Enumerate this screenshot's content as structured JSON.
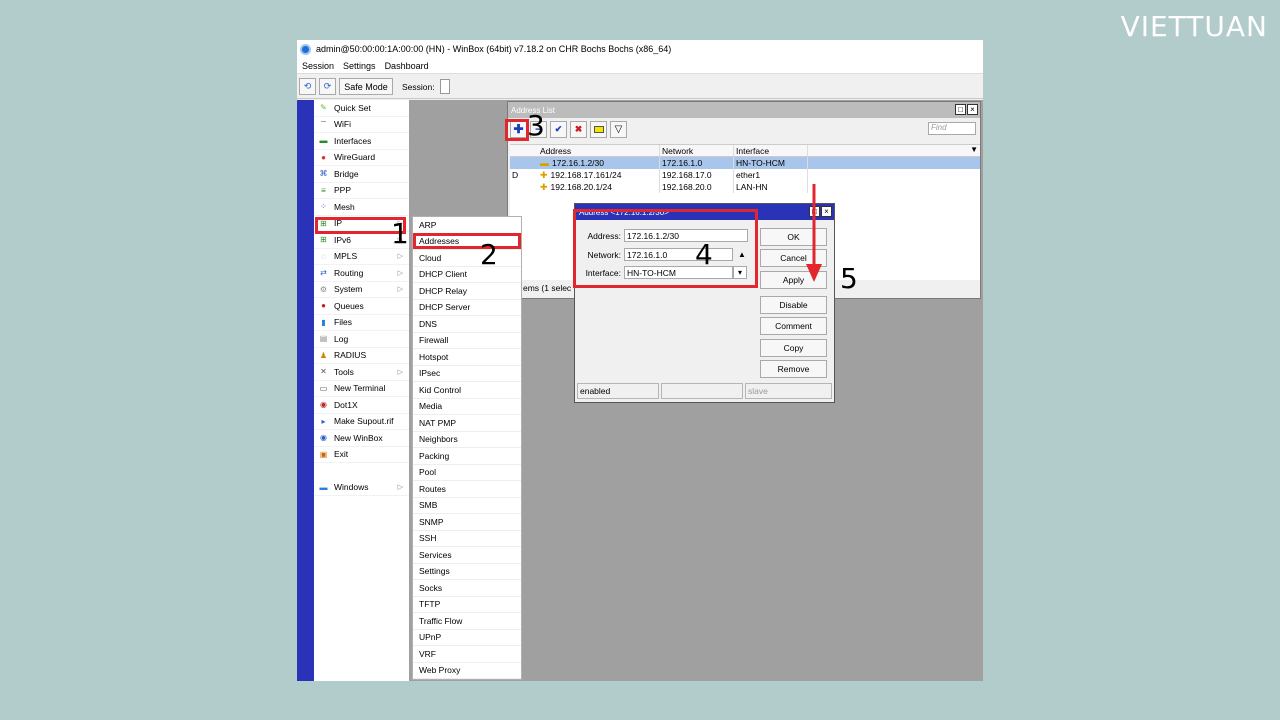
{
  "brand": "VIETTUAN",
  "window": {
    "title": "admin@50:00:00:1A:00:00 (HN) - WinBox (64bit) v7.18.2 on CHR Bochs Bochs (x86_64)",
    "menu": [
      "Session",
      "Settings",
      "Dashboard"
    ],
    "toolbar": {
      "undo": "⟲",
      "redo": "⟳",
      "safe_mode": "Safe Mode",
      "session_label": "Session:"
    }
  },
  "sidebar": {
    "items": [
      {
        "label": "Quick Set",
        "icon": "wand-icon"
      },
      {
        "label": "WiFi",
        "icon": "wifi-icon"
      },
      {
        "label": "Interfaces",
        "icon": "interfaces-icon"
      },
      {
        "label": "WireGuard",
        "icon": "wireguard-icon"
      },
      {
        "label": "Bridge",
        "icon": "bridge-icon"
      },
      {
        "label": "PPP",
        "icon": "ppp-icon"
      },
      {
        "label": "Mesh",
        "icon": "mesh-icon"
      },
      {
        "label": "IP",
        "icon": "ip-icon"
      },
      {
        "label": "IPv6",
        "icon": "ipv6-icon"
      },
      {
        "label": "MPLS",
        "icon": "mpls-icon"
      },
      {
        "label": "Routing",
        "icon": "routing-icon"
      },
      {
        "label": "System",
        "icon": "system-icon"
      },
      {
        "label": "Queues",
        "icon": "queues-icon"
      },
      {
        "label": "Files",
        "icon": "files-icon"
      },
      {
        "label": "Log",
        "icon": "log-icon"
      },
      {
        "label": "RADIUS",
        "icon": "radius-icon"
      },
      {
        "label": "Tools",
        "icon": "tools-icon"
      },
      {
        "label": "New Terminal",
        "icon": "terminal-icon"
      },
      {
        "label": "Dot1X",
        "icon": "dot1x-icon"
      },
      {
        "label": "Make Supout.rif",
        "icon": "supout-icon"
      },
      {
        "label": "New WinBox",
        "icon": "winbox-icon"
      },
      {
        "label": "Exit",
        "icon": "exit-icon"
      }
    ],
    "windows": "Windows"
  },
  "ip_menu": [
    "ARP",
    "Addresses",
    "Cloud",
    "DHCP Client",
    "DHCP Relay",
    "DHCP Server",
    "DNS",
    "Firewall",
    "Hotspot",
    "IPsec",
    "Kid Control",
    "Media",
    "NAT PMP",
    "Neighbors",
    "Packing",
    "Pool",
    "Routes",
    "SMB",
    "SNMP",
    "SSH",
    "Services",
    "Settings",
    "Socks",
    "TFTP",
    "Traffic Flow",
    "UPnP",
    "VRF",
    "Web Proxy"
  ],
  "address_list": {
    "title": "Address List",
    "find_placeholder": "Find",
    "columns": [
      "Address",
      "Network",
      "Interface"
    ],
    "rows": [
      {
        "flag": "",
        "address": "172.16.1.2/30",
        "network": "172.16.1.0",
        "interface": "HN-TO-HCM"
      },
      {
        "flag": "D",
        "address": "192.168.17.161/24",
        "network": "192.168.17.0",
        "interface": "ether1"
      },
      {
        "flag": "",
        "address": "192.168.20.1/24",
        "network": "192.168.20.0",
        "interface": "LAN-HN"
      }
    ],
    "items_text": "ems (1 selec"
  },
  "dialog": {
    "title": "Address <172.16.1.2/30>",
    "address_label": "Address:",
    "address_value": "172.16.1.2/30",
    "network_label": "Network:",
    "network_value": "172.16.1.0",
    "interface_label": "Interface:",
    "interface_value": "HN-TO-HCM",
    "buttons": {
      "ok": "OK",
      "cancel": "Cancel",
      "apply": "Apply",
      "disable": "Disable",
      "comment": "Comment",
      "copy": "Copy",
      "remove": "Remove"
    },
    "status": {
      "state": "enabled",
      "middle": "",
      "slave": "slave"
    }
  },
  "steps": [
    "1",
    "2",
    "3",
    "4",
    "5"
  ],
  "colors": {
    "highlight": "#e1262e",
    "sidebar": "#2a32b8",
    "selected_row": "#a8c5ec"
  }
}
